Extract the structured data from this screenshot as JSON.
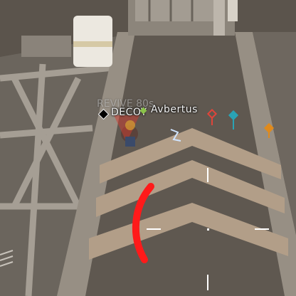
{
  "hud": {
    "revive_text": "REVIVE 80s",
    "decoy_label": "DECOY",
    "player_name": "Avbertus"
  },
  "colors": {
    "floor": "#5e574f",
    "beam": "#8a8177",
    "chevron": "#b7a18a",
    "damage_arc": "#ff1a1a",
    "crosshair": "#ffffff",
    "ping_red": "#e0443a",
    "ping_cyan": "#2aa3b5",
    "ping_orange": "#e08a1c"
  },
  "icons": [
    "decoy-diamond-icon",
    "ping-marker-icon",
    "crosshair-icon",
    "damage-indicator-icon",
    "player-icon",
    "crate-icon"
  ]
}
